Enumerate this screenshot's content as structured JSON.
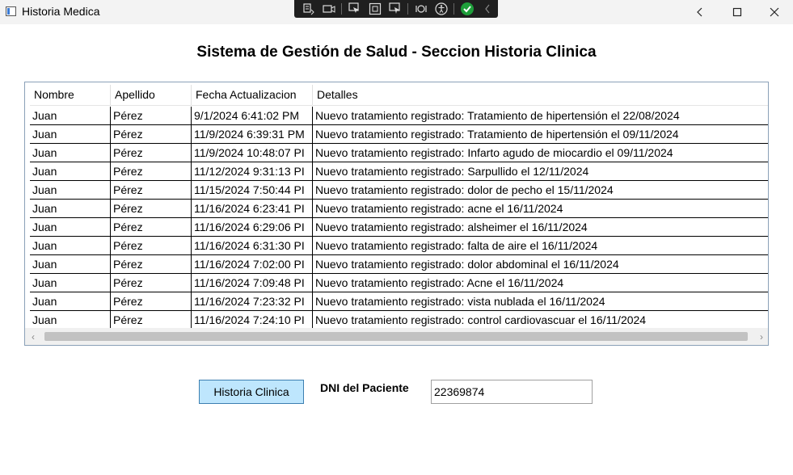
{
  "window": {
    "title": "Historia Medica"
  },
  "heading": "Sistema de Gestión de Salud - Seccion Historia Clinica",
  "grid": {
    "columns": [
      "Nombre",
      "Apellido",
      "Fecha Actualizacion",
      "Detalles"
    ],
    "rows": [
      [
        "Juan",
        "Pérez",
        "9/1/2024 6:41:02 PM",
        "Nuevo tratamiento registrado: Tratamiento de hipertensión el 22/08/2024"
      ],
      [
        "Juan",
        "Pérez",
        "11/9/2024 6:39:31 PM",
        "Nuevo tratamiento registrado: Tratamiento de hipertensión el 09/11/2024"
      ],
      [
        "Juan",
        "Pérez",
        "11/9/2024 10:48:07 PI",
        "Nuevo tratamiento registrado: Infarto agudo de miocardio el 09/11/2024"
      ],
      [
        "Juan",
        "Pérez",
        "11/12/2024 9:31:13 PI",
        "Nuevo tratamiento registrado: Sarpullido el 12/11/2024"
      ],
      [
        "Juan",
        "Pérez",
        "11/15/2024 7:50:44 PI",
        "Nuevo tratamiento registrado: dolor de pecho el 15/11/2024"
      ],
      [
        "Juan",
        "Pérez",
        "11/16/2024 6:23:41 PI",
        "Nuevo tratamiento registrado: acne el 16/11/2024"
      ],
      [
        "Juan",
        "Pérez",
        "11/16/2024 6:29:06 PI",
        "Nuevo tratamiento registrado: alsheimer el 16/11/2024"
      ],
      [
        "Juan",
        "Pérez",
        "11/16/2024 6:31:30 PI",
        "Nuevo tratamiento registrado: falta de aire el 16/11/2024"
      ],
      [
        "Juan",
        "Pérez",
        "11/16/2024 7:02:00 PI",
        "Nuevo tratamiento registrado: dolor abdominal el 16/11/2024"
      ],
      [
        "Juan",
        "Pérez",
        "11/16/2024 7:09:48 PI",
        "Nuevo tratamiento registrado: Acne el 16/11/2024"
      ],
      [
        "Juan",
        "Pérez",
        "11/16/2024 7:23:32 PI",
        "Nuevo tratamiento registrado: vista nublada el 16/11/2024"
      ],
      [
        "Juan",
        "Pérez",
        "11/16/2024 7:24:10 PI",
        "Nuevo tratamiento registrado: control cardiovascuar el 16/11/2024"
      ]
    ]
  },
  "actions": {
    "historia_button": "Historia Clinica",
    "dni_label": "DNI del Paciente",
    "dni_value": "22369874"
  },
  "colors": {
    "button_bg": "#bee6fd",
    "button_border": "#3c7fb1",
    "toolbar_bg": "#1f1f1f",
    "status_ok": "#1e9e3a"
  },
  "icons": [
    "app-window-icon",
    "minimize-icon",
    "maximize-icon",
    "close-icon",
    "live-visual-tree-icon",
    "record-icon",
    "select-element-icon",
    "display-layout-adorners-icon",
    "track-focus-icon",
    "hot-reload-icon",
    "accessibility-icon",
    "binding-ok-icon",
    "collapse-toolbar-icon"
  ]
}
